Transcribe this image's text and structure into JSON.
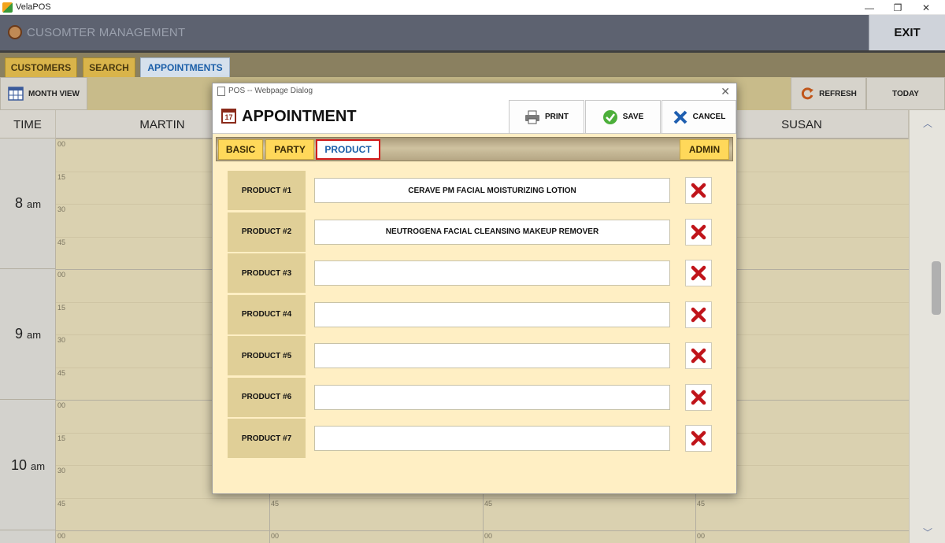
{
  "window": {
    "app_title": "VelaPOS",
    "minimize": "—",
    "restore": "❐",
    "close": "✕"
  },
  "header": {
    "title": "CUSOMTER MANAGEMENT",
    "exit_label": "EXIT"
  },
  "main_tabs": [
    {
      "label": "CUSTOMERS"
    },
    {
      "label": "SEARCH"
    },
    {
      "label": "APPOINTMENTS",
      "active": true
    }
  ],
  "toolbar": {
    "month_view_label": "MONTH VIEW",
    "refresh_label": "REFRESH",
    "today_label": "TODAY"
  },
  "calendar": {
    "time_header": "TIME",
    "staff": [
      "MARTIN",
      "SUSAN"
    ],
    "hours": [
      {
        "num": "8",
        "suffix": "am"
      },
      {
        "num": "9",
        "suffix": "am"
      },
      {
        "num": "10",
        "suffix": "am"
      }
    ],
    "slot_labels": [
      "00",
      "15",
      "30",
      "45"
    ],
    "scroll_up": "︿",
    "scroll_down": "﹀"
  },
  "dialog": {
    "window_title": "POS -- Webpage Dialog",
    "close": "✕",
    "heading": "APPOINTMENT",
    "calendar_icon_text": "17",
    "print_label": "PRINT",
    "save_label": "SAVE",
    "cancel_label": "CANCEL",
    "tabs": [
      {
        "label": "BASIC"
      },
      {
        "label": "PARTY"
      },
      {
        "label": "PRODUCT",
        "active": true
      }
    ],
    "admin_label": "ADMIN",
    "products": [
      {
        "label": "PRODUCT #1",
        "value": "CERAVE PM FACIAL MOISTURIZING LOTION"
      },
      {
        "label": "PRODUCT #2",
        "value": "NEUTROGENA FACIAL CLEANSING MAKEUP REMOVER"
      },
      {
        "label": "PRODUCT #3",
        "value": ""
      },
      {
        "label": "PRODUCT #4",
        "value": ""
      },
      {
        "label": "PRODUCT #5",
        "value": ""
      },
      {
        "label": "PRODUCT #6",
        "value": ""
      },
      {
        "label": "PRODUCT #7",
        "value": ""
      }
    ]
  },
  "colors": {
    "accent": "#1a5ea8",
    "tab_yellow": "#ffd85a",
    "delete_red": "#c0141a",
    "save_green": "#4caf3a"
  }
}
